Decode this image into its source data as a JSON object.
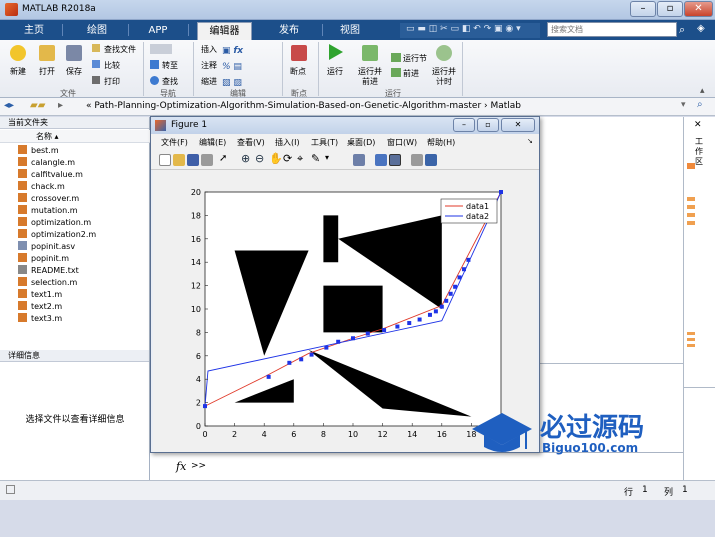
{
  "window": {
    "title": "MATLAB R2018a"
  },
  "tabs": [
    "主页",
    "绘图",
    "APP",
    "编辑器",
    "发布",
    "视图"
  ],
  "search": {
    "placeholder": "搜索文档"
  },
  "ribbon": {
    "new": "新建",
    "open": "打开",
    "save": "保存",
    "find_files": "查找文件",
    "compare": "比较",
    "print": "打印",
    "goto": "转至",
    "find": "查找",
    "insert": "插入",
    "comment": "注释",
    "indent": "缩进",
    "breakpoints": "断点",
    "run": "运行",
    "run_advance": [
      "运行并",
      "前进"
    ],
    "run_section": "运行节",
    "advance": "前进",
    "run_time": [
      "运行并",
      "计时"
    ],
    "groups": {
      "file": "文件",
      "navigate": "导航",
      "edit": "编辑",
      "breakpoints": "断点",
      "run": "运行"
    }
  },
  "pathbar": {
    "path": "« Path-Planning-Optimization-Algorithm-Simulation-Based-on-Genetic-Algorithm-master › Matlab",
    "right_text": "机器人路径规划\\Path-Plannin..."
  },
  "folder": {
    "title": "当前文件夹",
    "col_name": "名称 ▴",
    "files": [
      "best.m",
      "calangle.m",
      "calfitvalue.m",
      "chack.m",
      "crossover.m",
      "mutation.m",
      "optimization.m",
      "optimization2.m",
      "popinit.asv",
      "popinit.m",
      "README.txt",
      "selection.m",
      "text1.m",
      "text2.m",
      "text3.m"
    ]
  },
  "details": {
    "title": "详细信息",
    "message": "选择文件以查看详细信息"
  },
  "right_panel": {
    "label": "工作区"
  },
  "command": {
    "fx": "fx",
    "prompt": ">>"
  },
  "status": {
    "row_label": "行",
    "row": "1",
    "col_label": "列",
    "col": "1"
  },
  "figure": {
    "title": "Figure 1",
    "menu": [
      "文件(F)",
      "编辑(E)",
      "查看(V)",
      "插入(I)",
      "工具(T)",
      "桌面(D)",
      "窗口(W)",
      "帮助(H)"
    ]
  },
  "chart_data": {
    "type": "line",
    "xlim": [
      0,
      20
    ],
    "ylim": [
      0,
      20
    ],
    "xticks": [
      "0",
      "2",
      "4",
      "6",
      "8",
      "10",
      "12",
      "14",
      "16",
      "18"
    ],
    "yticks": [
      "0",
      "2",
      "4",
      "6",
      "8",
      "10",
      "12",
      "14",
      "16",
      "18",
      "20"
    ],
    "legend_position": "top-right",
    "series": [
      {
        "name": "data1",
        "color": "#e03a2a",
        "x": [
          0,
          4,
          7,
          10,
          12,
          16,
          20
        ],
        "y": [
          1.7,
          4.2,
          6.2,
          7.5,
          8.3,
          10.3,
          20
        ]
      },
      {
        "name": "data2",
        "color": "#1e33e6",
        "x": [
          0,
          0.2,
          16,
          20
        ],
        "y": [
          1.7,
          4.7,
          9,
          20
        ]
      }
    ],
    "markers": [
      [
        0,
        1.7
      ],
      [
        4.3,
        4.2
      ],
      [
        5.7,
        5.4
      ],
      [
        6.5,
        5.7
      ],
      [
        7.2,
        6.1
      ],
      [
        8.2,
        6.7
      ],
      [
        9,
        7.2
      ],
      [
        10,
        7.5
      ],
      [
        11,
        7.9
      ],
      [
        12.1,
        8.2
      ],
      [
        13,
        8.5
      ],
      [
        13.8,
        8.8
      ],
      [
        14.5,
        9.1
      ],
      [
        15.2,
        9.5
      ],
      [
        15.6,
        9.8
      ],
      [
        16,
        10.2
      ],
      [
        16.3,
        10.7
      ],
      [
        16.6,
        11.3
      ],
      [
        16.9,
        11.9
      ],
      [
        17.2,
        12.7
      ],
      [
        17.5,
        13.4
      ],
      [
        17.8,
        14.2
      ],
      [
        20,
        20
      ]
    ],
    "obstacles": [
      [
        [
          2,
          15
        ],
        [
          7,
          15
        ],
        [
          4,
          6
        ]
      ],
      [
        [
          8,
          18
        ],
        [
          9,
          18
        ],
        [
          9,
          14
        ],
        [
          8,
          14
        ]
      ],
      [
        [
          9,
          16
        ],
        [
          16,
          18
        ],
        [
          16,
          10
        ]
      ],
      [
        [
          8,
          12
        ],
        [
          12,
          12
        ],
        [
          12,
          8
        ],
        [
          8,
          8
        ]
      ],
      [
        [
          2,
          2
        ],
        [
          6,
          4
        ],
        [
          6,
          2
        ]
      ],
      [
        [
          7,
          6.5
        ],
        [
          18,
          0.8
        ],
        [
          12,
          1.5
        ]
      ]
    ]
  },
  "watermark": {
    "text": "必过源码",
    "sub": "Biguo100.com"
  }
}
